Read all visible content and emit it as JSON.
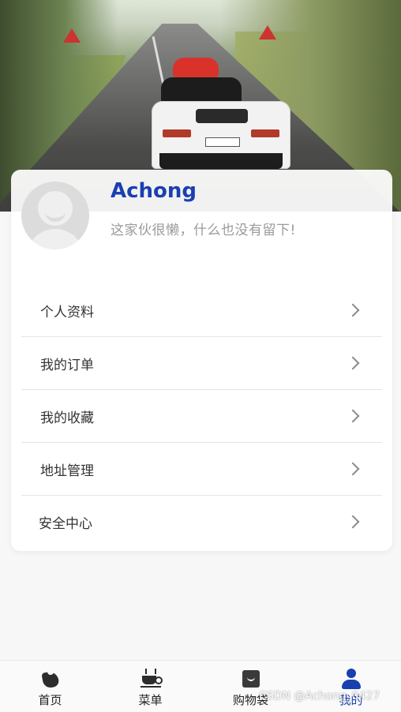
{
  "profile": {
    "username": "Achong",
    "bio": "这家伙很懒，什么也没有留下!"
  },
  "menu": {
    "items": [
      {
        "label": "个人资料"
      },
      {
        "label": "我的订单"
      },
      {
        "label": "我的收藏"
      },
      {
        "label": "地址管理"
      },
      {
        "label": "安全中心"
      }
    ]
  },
  "tabbar": {
    "tabs": [
      {
        "label": "首页",
        "icon": "home-icon"
      },
      {
        "label": "菜单",
        "icon": "coffee-cup-icon"
      },
      {
        "label": "购物袋",
        "icon": "shopping-bag-icon"
      },
      {
        "label": "我的",
        "icon": "user-icon",
        "active": true
      }
    ]
  },
  "watermark": "CSDN @Achong_0427",
  "colors": {
    "accent": "#1a3fb0",
    "muted_text": "#9a9a9a",
    "background": "#f7f7f7"
  }
}
